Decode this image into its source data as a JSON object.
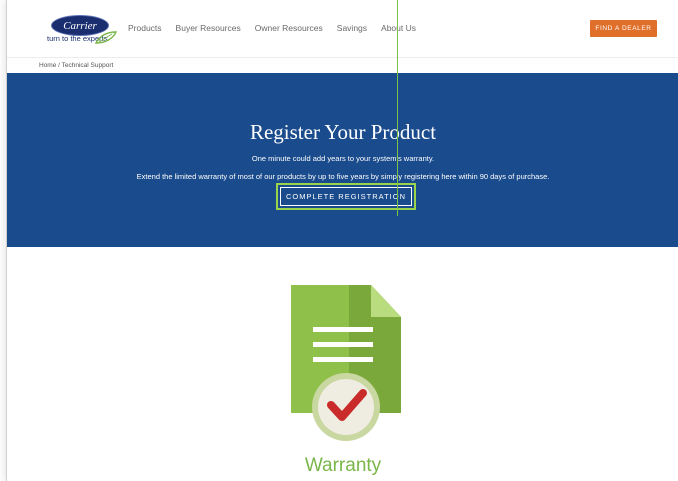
{
  "logo": {
    "brand": "Carrier",
    "tagline": "turn to the experts"
  },
  "nav": {
    "items": [
      {
        "label": "Products"
      },
      {
        "label": "Buyer Resources"
      },
      {
        "label": "Owner Resources"
      },
      {
        "label": "Savings"
      },
      {
        "label": "About Us"
      }
    ],
    "dealer_button": "FIND A DEALER"
  },
  "breadcrumb": "Home  /  Technical Support",
  "hero": {
    "title": "Register Your Product",
    "subtitle": "One minute could add years to your system's warranty.",
    "description": "Extend the limited warranty of most of our products by up to five years by simply registering here within 90 days of purchase.",
    "cta": "COMPLETE REGISTRATION"
  },
  "warranty": {
    "label": "Warranty",
    "icon": "document-checkmark-icon"
  },
  "colors": {
    "hero_bg": "#1a4b8c",
    "accent_orange": "#e06f2a",
    "accent_green": "#7ab648"
  }
}
